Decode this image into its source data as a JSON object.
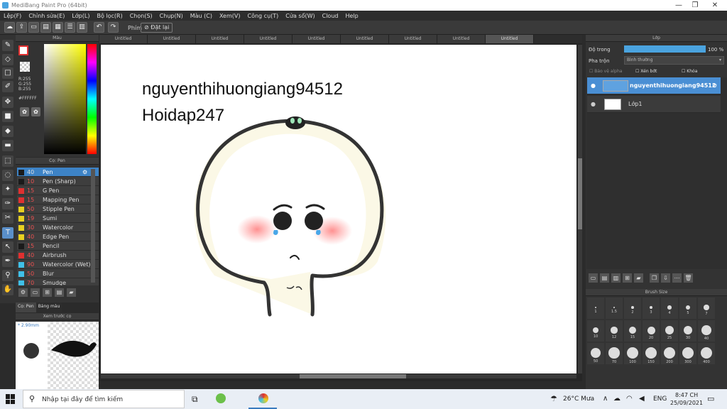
{
  "window": {
    "title": "MediBang Paint Pro (64bit)",
    "min": "—",
    "max": "❐",
    "close": "✕"
  },
  "menu": [
    "Lệp(F)",
    "Chỉnh sửa(E)",
    "Lớp(L)",
    "Bộ lọc(R)",
    "Chọn(S)",
    "Chụp(N)",
    "Màu (C)",
    "Xem(V)",
    "Công cụ(T)",
    "Cửa sổ(W)",
    "Cloud",
    "Help"
  ],
  "toolbar": {
    "hand_label": "Phím",
    "reset_label": "Đặt lại"
  },
  "panels": {
    "color_title": "Màu",
    "brush_title": "Cọ: Pen",
    "preview_title": "Xem trước cọ",
    "layer_title": "Lớp",
    "brushsize_title": "Brush Size"
  },
  "color": {
    "rgb": [
      "R:255",
      "G:255",
      "B:255"
    ],
    "hex": "#FFFFFF"
  },
  "brushes": [
    {
      "size": "40",
      "name": "Pen",
      "color": "#1a1a1a"
    },
    {
      "size": "10",
      "name": "Pen (Sharp)",
      "color": "#1a1a1a"
    },
    {
      "size": "15",
      "name": "G Pen",
      "color": "#e03030"
    },
    {
      "size": "15",
      "name": "Mapping Pen",
      "color": "#e03030"
    },
    {
      "size": "50",
      "name": "Stipple Pen",
      "color": "#e8d020"
    },
    {
      "size": "19",
      "name": "Sumi",
      "color": "#e8d020"
    },
    {
      "size": "30",
      "name": "Watercolor",
      "color": "#e8d020"
    },
    {
      "size": "40",
      "name": "Edge Pen",
      "color": "#e8d020"
    },
    {
      "size": "15",
      "name": "Pencil",
      "color": "#1a1a1a"
    },
    {
      "size": "40",
      "name": "Airbrush",
      "color": "#e03030"
    },
    {
      "size": "90",
      "name": "Watercolor (Wet)",
      "color": "#40c0e8"
    },
    {
      "size": "50",
      "name": "Blur",
      "color": "#40c0e8"
    },
    {
      "size": "70",
      "name": "Smudge",
      "color": "#40c0e8"
    }
  ],
  "brush_tabs": [
    "Cọ: Pen",
    "Bảng màu"
  ],
  "preview": {
    "size_label": "* 2.90mm"
  },
  "tabs": [
    "Untitled",
    "Untitled",
    "Untitled",
    "Untitled",
    "Untitled",
    "Untitled",
    "Untitled",
    "Untitled",
    "Untitled"
  ],
  "canvas_text": {
    "line1": "nguyenthihuongiang94512",
    "line2": "Hoidap247"
  },
  "layers": {
    "opacity_label": "Độ trong",
    "opacity_value": "100 %",
    "blend_label": "Pha trộn",
    "blend_value": "Bình thường",
    "protect_alpha": "Bảo vệ alpha",
    "clipping": "Xén bớt",
    "lock": "Khóa",
    "items": [
      {
        "name": "nguyenthihuongiang94512",
        "selected": true
      },
      {
        "name": "Lớp1",
        "selected": false
      }
    ]
  },
  "brush_sizes": [
    "1",
    "1.5",
    "2",
    "3",
    "4",
    "5",
    "7",
    "10",
    "12",
    "15",
    "20",
    "25",
    "30",
    "40",
    "50",
    "70",
    "100",
    "150",
    "200",
    "300",
    "400"
  ],
  "taskbar": {
    "search_placeholder": "Nhập tại đây để tìm kiếm",
    "weather": "26°C Mưa",
    "lang": "ENG",
    "time": "8:47 CH",
    "date": "25/09/2021"
  }
}
